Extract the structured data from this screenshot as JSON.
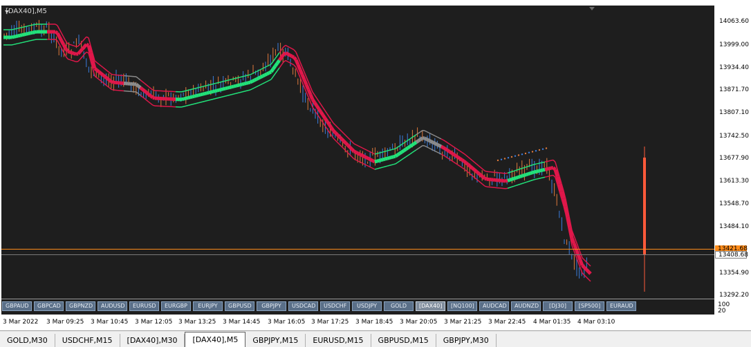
{
  "chart": {
    "symbol_title": "[DAX40],M5",
    "current_price": "13421.68",
    "second_price": "13408.68",
    "price_axis": [
      "14063.60",
      "13999.00",
      "13934.40",
      "13871.70",
      "13807.10",
      "13742.50",
      "13677.90",
      "13613.30",
      "13548.70",
      "13484.10",
      "13421.68",
      "13354.90",
      "13292.20"
    ],
    "time_axis": [
      "3 Mar 2022",
      "3 Mar 09:25",
      "3 Mar 10:45",
      "3 Mar 12:05",
      "3 Mar 13:25",
      "3 Mar 14:45",
      "3 Mar 16:05",
      "3 Mar 17:25",
      "3 Mar 18:45",
      "3 Mar 20:05",
      "3 Mar 21:25",
      "3 Mar 22:45",
      "4 Mar 01:35",
      "4 Mar 03:10"
    ],
    "indicator_axis": [
      "100",
      "20"
    ],
    "colors": {
      "background": "#1e1e1e",
      "bull": "#3b7ddd",
      "bear": "#e07a3c",
      "up_trend": "#22e37a",
      "down_trend": "#e0174a",
      "neutral": "#8c8c8c",
      "price_line": "#ff8c1a"
    }
  },
  "symbol_buttons": [
    "GBPAUD",
    "GBPCAD",
    "GBPNZD",
    "AUDUSD",
    "EURUSD",
    "EURGBP",
    "EURJPY",
    "GBPUSD",
    "GBPJPY",
    "USDCAD",
    "USDCHF",
    "USDJPY",
    "GOLD",
    "[DAX40]",
    "[NQ100]",
    "AUDCAD",
    "AUDNZD",
    "[DJ30]",
    "[SP500]",
    "EURAUD"
  ],
  "active_symbol": "[DAX40]",
  "tabs": [
    {
      "label": "GOLD,M30"
    },
    {
      "label": "USDCHF,M15"
    },
    {
      "label": "[DAX40],M30"
    },
    {
      "label": "[DAX40],M5",
      "active": true
    },
    {
      "label": "GBPJPY,M15"
    },
    {
      "label": "EURUSD,M15"
    },
    {
      "label": "GBPUSD,M15"
    },
    {
      "label": "GBPJPY,M30"
    }
  ]
}
